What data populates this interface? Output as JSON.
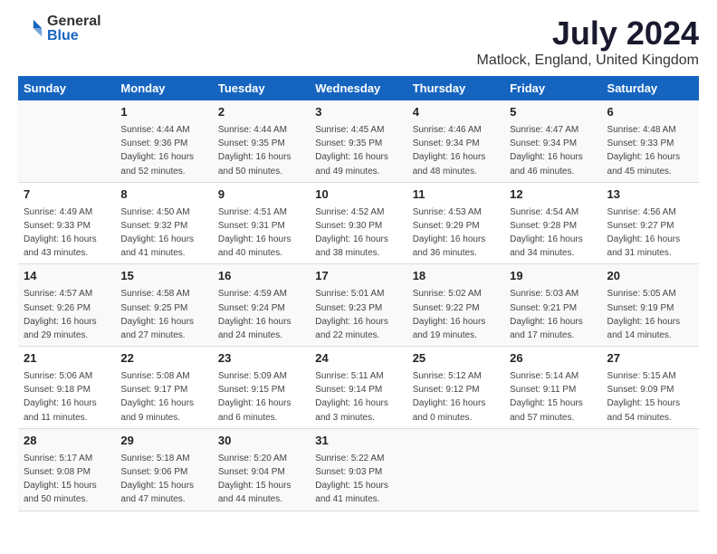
{
  "logo": {
    "general": "General",
    "blue": "Blue"
  },
  "title": "July 2024",
  "location": "Matlock, England, United Kingdom",
  "days_of_week": [
    "Sunday",
    "Monday",
    "Tuesday",
    "Wednesday",
    "Thursday",
    "Friday",
    "Saturday"
  ],
  "weeks": [
    [
      {
        "day": "",
        "info": ""
      },
      {
        "day": "1",
        "info": "Sunrise: 4:44 AM\nSunset: 9:36 PM\nDaylight: 16 hours\nand 52 minutes."
      },
      {
        "day": "2",
        "info": "Sunrise: 4:44 AM\nSunset: 9:35 PM\nDaylight: 16 hours\nand 50 minutes."
      },
      {
        "day": "3",
        "info": "Sunrise: 4:45 AM\nSunset: 9:35 PM\nDaylight: 16 hours\nand 49 minutes."
      },
      {
        "day": "4",
        "info": "Sunrise: 4:46 AM\nSunset: 9:34 PM\nDaylight: 16 hours\nand 48 minutes."
      },
      {
        "day": "5",
        "info": "Sunrise: 4:47 AM\nSunset: 9:34 PM\nDaylight: 16 hours\nand 46 minutes."
      },
      {
        "day": "6",
        "info": "Sunrise: 4:48 AM\nSunset: 9:33 PM\nDaylight: 16 hours\nand 45 minutes."
      }
    ],
    [
      {
        "day": "7",
        "info": "Sunrise: 4:49 AM\nSunset: 9:33 PM\nDaylight: 16 hours\nand 43 minutes."
      },
      {
        "day": "8",
        "info": "Sunrise: 4:50 AM\nSunset: 9:32 PM\nDaylight: 16 hours\nand 41 minutes."
      },
      {
        "day": "9",
        "info": "Sunrise: 4:51 AM\nSunset: 9:31 PM\nDaylight: 16 hours\nand 40 minutes."
      },
      {
        "day": "10",
        "info": "Sunrise: 4:52 AM\nSunset: 9:30 PM\nDaylight: 16 hours\nand 38 minutes."
      },
      {
        "day": "11",
        "info": "Sunrise: 4:53 AM\nSunset: 9:29 PM\nDaylight: 16 hours\nand 36 minutes."
      },
      {
        "day": "12",
        "info": "Sunrise: 4:54 AM\nSunset: 9:28 PM\nDaylight: 16 hours\nand 34 minutes."
      },
      {
        "day": "13",
        "info": "Sunrise: 4:56 AM\nSunset: 9:27 PM\nDaylight: 16 hours\nand 31 minutes."
      }
    ],
    [
      {
        "day": "14",
        "info": "Sunrise: 4:57 AM\nSunset: 9:26 PM\nDaylight: 16 hours\nand 29 minutes."
      },
      {
        "day": "15",
        "info": "Sunrise: 4:58 AM\nSunset: 9:25 PM\nDaylight: 16 hours\nand 27 minutes."
      },
      {
        "day": "16",
        "info": "Sunrise: 4:59 AM\nSunset: 9:24 PM\nDaylight: 16 hours\nand 24 minutes."
      },
      {
        "day": "17",
        "info": "Sunrise: 5:01 AM\nSunset: 9:23 PM\nDaylight: 16 hours\nand 22 minutes."
      },
      {
        "day": "18",
        "info": "Sunrise: 5:02 AM\nSunset: 9:22 PM\nDaylight: 16 hours\nand 19 minutes."
      },
      {
        "day": "19",
        "info": "Sunrise: 5:03 AM\nSunset: 9:21 PM\nDaylight: 16 hours\nand 17 minutes."
      },
      {
        "day": "20",
        "info": "Sunrise: 5:05 AM\nSunset: 9:19 PM\nDaylight: 16 hours\nand 14 minutes."
      }
    ],
    [
      {
        "day": "21",
        "info": "Sunrise: 5:06 AM\nSunset: 9:18 PM\nDaylight: 16 hours\nand 11 minutes."
      },
      {
        "day": "22",
        "info": "Sunrise: 5:08 AM\nSunset: 9:17 PM\nDaylight: 16 hours\nand 9 minutes."
      },
      {
        "day": "23",
        "info": "Sunrise: 5:09 AM\nSunset: 9:15 PM\nDaylight: 16 hours\nand 6 minutes."
      },
      {
        "day": "24",
        "info": "Sunrise: 5:11 AM\nSunset: 9:14 PM\nDaylight: 16 hours\nand 3 minutes."
      },
      {
        "day": "25",
        "info": "Sunrise: 5:12 AM\nSunset: 9:12 PM\nDaylight: 16 hours\nand 0 minutes."
      },
      {
        "day": "26",
        "info": "Sunrise: 5:14 AM\nSunset: 9:11 PM\nDaylight: 15 hours\nand 57 minutes."
      },
      {
        "day": "27",
        "info": "Sunrise: 5:15 AM\nSunset: 9:09 PM\nDaylight: 15 hours\nand 54 minutes."
      }
    ],
    [
      {
        "day": "28",
        "info": "Sunrise: 5:17 AM\nSunset: 9:08 PM\nDaylight: 15 hours\nand 50 minutes."
      },
      {
        "day": "29",
        "info": "Sunrise: 5:18 AM\nSunset: 9:06 PM\nDaylight: 15 hours\nand 47 minutes."
      },
      {
        "day": "30",
        "info": "Sunrise: 5:20 AM\nSunset: 9:04 PM\nDaylight: 15 hours\nand 44 minutes."
      },
      {
        "day": "31",
        "info": "Sunrise: 5:22 AM\nSunset: 9:03 PM\nDaylight: 15 hours\nand 41 minutes."
      },
      {
        "day": "",
        "info": ""
      },
      {
        "day": "",
        "info": ""
      },
      {
        "day": "",
        "info": ""
      }
    ]
  ]
}
